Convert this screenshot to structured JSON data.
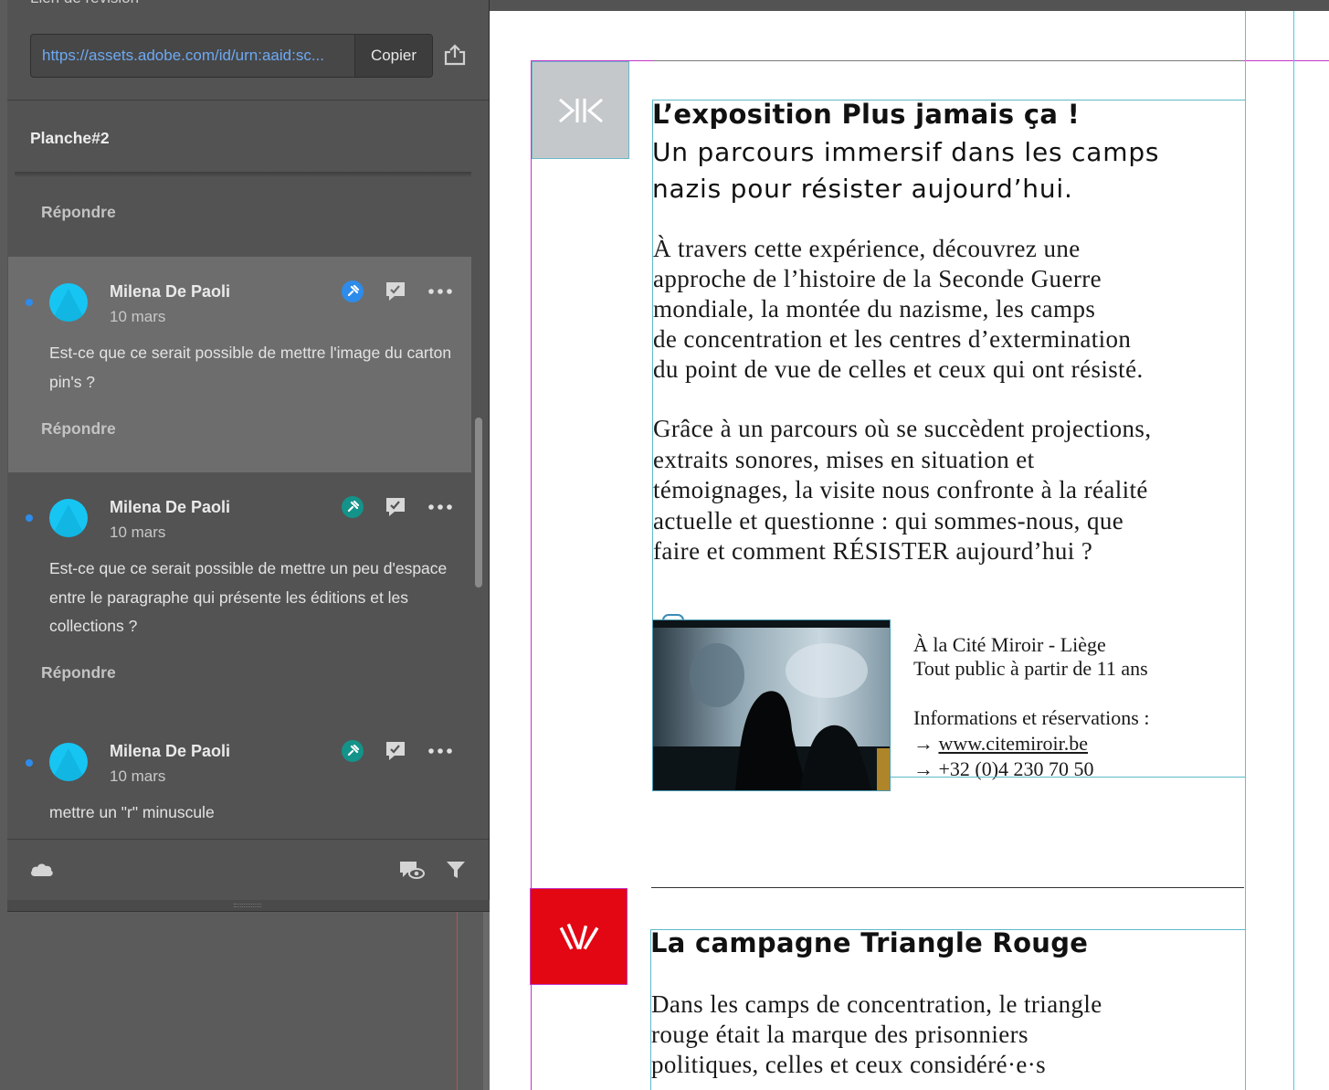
{
  "panel": {
    "section_label": "Lien de révision",
    "review_url": "https://assets.adobe.com/id/urn:aaid:sc...",
    "copy_label": "Copier",
    "spread_label": "Planche#2",
    "top_reply": "Répondre",
    "comments": [
      {
        "author": "Milena De Paoli",
        "date": "10 mars",
        "text": "Est-ce que ce serait possible de mettre l'image du carton pin's ?",
        "reply": "Répondre",
        "pin_color": "#2d8ceb"
      },
      {
        "author": "Milena De Paoli",
        "date": "10 mars",
        "text": "Est-ce que ce serait possible de mettre un peu d'espace entre le paragraphe qui présente les éditions et les collections ?",
        "reply": "Répondre",
        "pin_color": "#13938a"
      },
      {
        "author": "Milena De Paoli",
        "date": "10 mars",
        "text": "mettre un \"r\" minuscule",
        "reply": "",
        "pin_color": "#13938a"
      }
    ]
  },
  "document": {
    "exhibition": {
      "title": "L’exposition Plus jamais ça !",
      "subtitle_line1": "Un parcours immersif dans les camps",
      "subtitle_line2": "nazis pour résister aujourd’hui.",
      "para1": [
        "À travers cette expérience, découvrez une",
        "approche de l’histoire de la Seconde Guerre",
        "mondiale, la montée du nazisme, les camps",
        "de concentration et les centres d’extermination",
        "du point de vue de celles et ceux qui ont résisté."
      ],
      "para2": [
        "Grâce à un parcours où se succèdent projections,",
        "extraits sonores, mises en situation et",
        "témoignages, la visite nous confronte à la réalité",
        "actuelle et questionne : qui sommes-nous, que",
        "faire et comment RÉSISTER aujourd’hui ?"
      ],
      "info": {
        "location": "À la Cité Miroir - Liège",
        "audience": "Tout public à partir de 11 ans",
        "info_title": "Informations et réservations :",
        "website": "www.citemiroir.be",
        "phone": "+32 (0)4 230 70 50"
      }
    },
    "campaign": {
      "title": "La campagne Triangle Rouge",
      "para": [
        "Dans les camps de concentration, le triangle",
        "rouge était la marque des prisonniers",
        "politiques, celles et ceux considéré·e·s"
      ]
    }
  },
  "colors": {
    "panel_bg": "#535353",
    "accent_blue": "#2d8ceb",
    "avatar": "#17c5f3",
    "triangle_red": "#e30613",
    "frame_cyan": "#3fb5c8",
    "margin_magenta": "#c236c9"
  }
}
